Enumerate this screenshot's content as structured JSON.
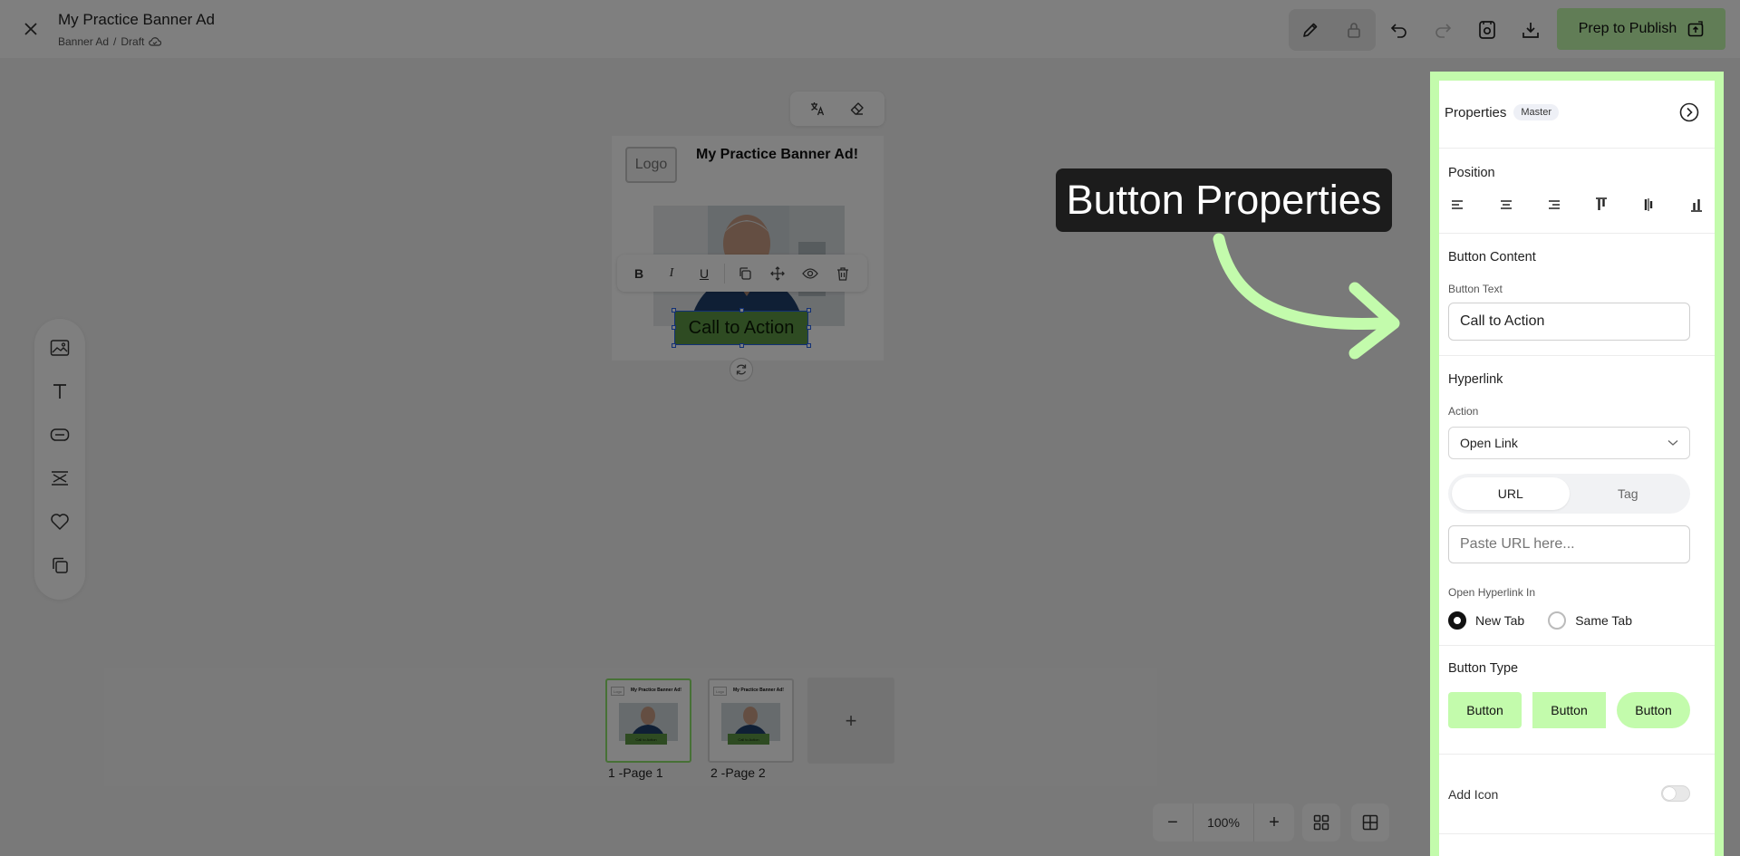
{
  "header": {
    "title": "My Practice Banner Ad",
    "breadcrumb": [
      "Banner Ad",
      "Draft"
    ],
    "breadcrumb_separator": "/",
    "publish_label": "Prep to Publish"
  },
  "canvas": {
    "banner_logo": "Logo",
    "banner_title": "My Practice Banner Ad!",
    "cta_text": "Call to Action",
    "text_toolbar": {
      "bold": "B",
      "italic": "I",
      "underline": "U"
    }
  },
  "pages": [
    {
      "label": "1 -Page 1",
      "thumb_logo": "Logo",
      "thumb_title": "My Practice Banner Ad!",
      "thumb_cta": "Call to Action"
    },
    {
      "label": "2 -Page 2",
      "thumb_logo": "Logo",
      "thumb_title": "My Practice Banner Ad!",
      "thumb_cta": "Call to Action"
    }
  ],
  "add_page_symbol": "+",
  "zoom": {
    "value": "100%",
    "minus": "−",
    "plus": "+"
  },
  "callout": {
    "text": "Button Properties"
  },
  "panel": {
    "title": "Properties",
    "badge": "Master",
    "position_title": "Position",
    "button_content_title": "Button Content",
    "button_text_label": "Button Text",
    "button_text_value": "Call to Action",
    "hyperlink_title": "Hyperlink",
    "action_label": "Action",
    "action_value": "Open Link",
    "segment": [
      "URL",
      "Tag"
    ],
    "url_placeholder": "Paste URL here...",
    "open_in_label": "Open Hyperlink In",
    "open_in_options": [
      "New Tab",
      "Same Tab"
    ],
    "button_type_title": "Button Type",
    "button_types": [
      "Button",
      "Button",
      "Button"
    ],
    "add_icon_label": "Add Icon"
  },
  "colors": {
    "accent": "#c3fbac",
    "cta_fill": "#5d9745",
    "selection": "#2563eb",
    "callout_bg": "#1c1c1c"
  },
  "icons": {
    "topbar": [
      "close-icon",
      "cloud-icon",
      "pencil-icon",
      "lock-icon",
      "undo-icon",
      "redo-icon",
      "preview-icon",
      "download-icon",
      "publish-icon"
    ],
    "left_toolbar": [
      "image-icon",
      "text-icon",
      "button-icon",
      "spacer-icon",
      "heart-icon",
      "layers-icon"
    ]
  }
}
